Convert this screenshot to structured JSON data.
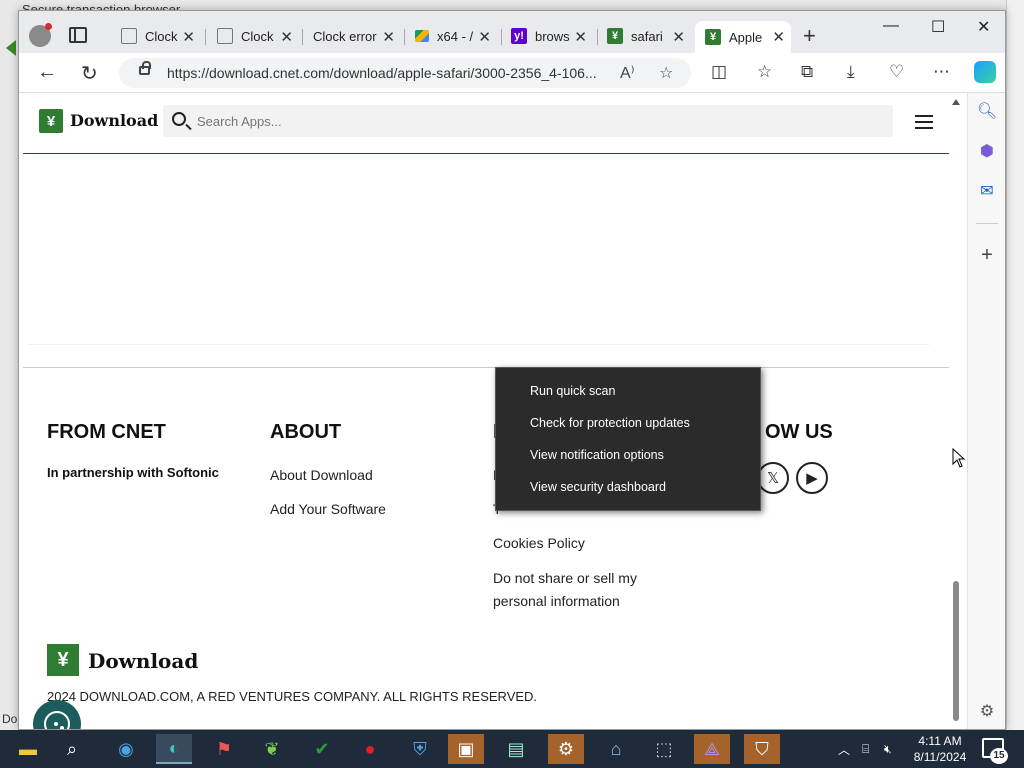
{
  "background_window": {
    "title": "Secure transaction browser",
    "status_fragment": "Do"
  },
  "browser": {
    "tabs": [
      {
        "label": "Clock",
        "favicon": "page-icon",
        "color": "#9e9e9e"
      },
      {
        "label": "Clock",
        "favicon": "page-icon",
        "color": "#9e9e9e"
      },
      {
        "label": "Clock error",
        "favicon": "",
        "color": ""
      },
      {
        "label": "x64 - /",
        "favicon": "drive-icon",
        "color": "#f4b400"
      },
      {
        "label": "brows",
        "favicon": "yahoo-icon",
        "color": "#6001d2"
      },
      {
        "label": "safari",
        "favicon": "download-icon",
        "color": "#2e7d32"
      },
      {
        "label": "Apple",
        "favicon": "download-icon",
        "color": "#2e7d32",
        "active": true
      }
    ],
    "url": "https://download.cnet.com/download/apple-safari/3000-2356_4-106..."
  },
  "site": {
    "logo_text": "Download",
    "search_placeholder": "Search Apps...",
    "footer": {
      "col1_title": "FROM CNET",
      "col1_text": "In partnership with Softonic",
      "col2_title": "ABOUT",
      "col2_links": [
        "About Download",
        "Add Your Software"
      ],
      "col3_title_fragment": "L",
      "col3_fragment_1": "P",
      "col3_fragment_2": "T",
      "col3_links": [
        "Cookies Policy",
        "Do not share or sell my",
        "personal information"
      ],
      "col4_title_prefix": "F",
      "col4_title": "OW US",
      "social": [
        "facebook-icon",
        "x-icon",
        "youtube-icon"
      ],
      "logo_text": "Download",
      "copyright": "2024 DOWNLOAD.COM, A RED VENTURES COMPANY. ALL RIGHTS RESERVED."
    }
  },
  "context_menu": {
    "items": [
      "Run quick scan",
      "Check for protection updates",
      "View notification options",
      "View security dashboard"
    ]
  },
  "taskbar": {
    "time": "4:11 AM",
    "date": "8/11/2024",
    "notification_count": "15"
  },
  "colors": {
    "brand_green": "#2e7d32",
    "taskbar": "#1f2a3a",
    "menu_bg": "#2b2b2b"
  }
}
